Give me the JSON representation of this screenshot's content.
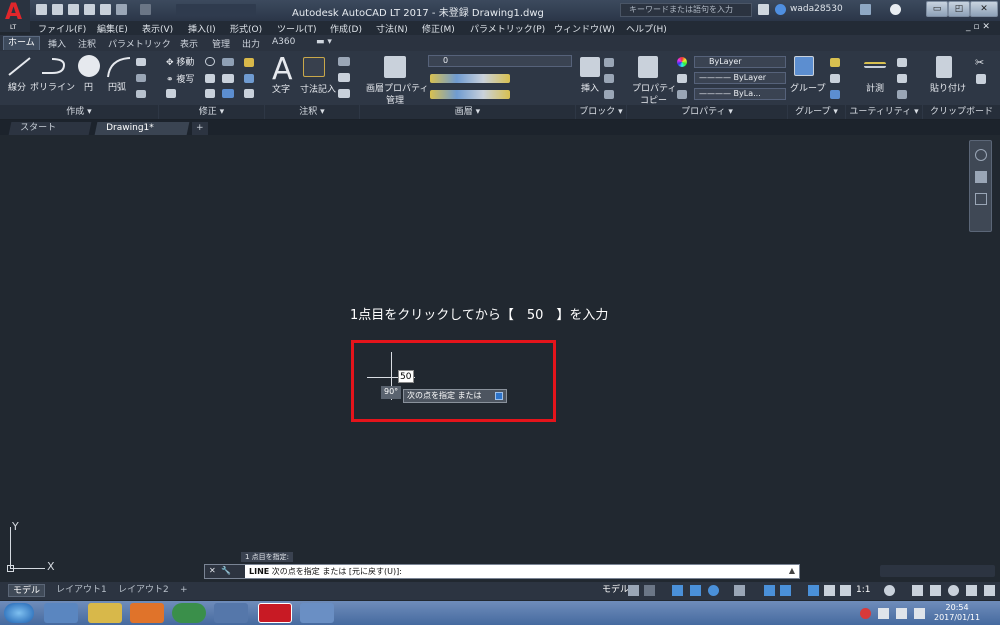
{
  "titlebar": {
    "title": "Autodesk AutoCAD LT 2017 - 未登録    Drawing1.dwg",
    "search_placeholder": "キーワードまたは語句を入力",
    "user": "wada28530",
    "app_logo_letter": "A",
    "app_logo_sub": "LT"
  },
  "menubar": [
    "ファイル(F)",
    "編集(E)",
    "表示(V)",
    "挿入(I)",
    "形式(O)",
    "ツール(T)",
    "作成(D)",
    "寸法(N)",
    "修正(M)",
    "パラメトリック(P)",
    "ウィンドウ(W)",
    "ヘルプ(H)"
  ],
  "ribbon_tabs": [
    "ホーム",
    "挿入",
    "注釈",
    "パラメトリック",
    "表示",
    "管理",
    "出力",
    "A360"
  ],
  "ribbon": {
    "draw": {
      "line": "線分",
      "polyline": "ポリライン",
      "circle": "円",
      "arc": "円弧",
      "footer": "作成 ▾"
    },
    "modify": {
      "move": "移動",
      "copy": "複写",
      "footer": "修正 ▾"
    },
    "annotation": {
      "text": "文字",
      "dimension": "寸法記入",
      "footer": "注釈 ▾"
    },
    "layers": {
      "props_line1": "画層プロパティ",
      "props_line2": "管理",
      "current_layer": "0",
      "footer": "画層 ▾"
    },
    "block": {
      "insert": "挿入",
      "footer": "ブロック ▾"
    },
    "properties": {
      "match_line1": "プロパティ",
      "match_line2": "コピー",
      "bylayer1": "ByLayer",
      "bylayer2": "———— ByLayer",
      "bylayer3": "———— ByLa...",
      "footer": "プロパティ ▾"
    },
    "groups": {
      "group": "グループ",
      "footer": "グループ ▾"
    },
    "utilities": {
      "measure": "計測",
      "footer": "ユーティリティ ▾"
    },
    "clipboard": {
      "paste": "貼り付け",
      "footer": "クリップボード"
    }
  },
  "doc_tabs": [
    "スタート",
    "Drawing1*"
  ],
  "canvas": {
    "instruction": "1点目をクリックしてから【　50　】を入力",
    "dynamic_input_value": "50",
    "angle": "90°",
    "prompt": "次の点を指定 または",
    "ucs_x": "X",
    "ucs_y": "Y"
  },
  "command": {
    "history": "1 点目を指定:",
    "command_name": "LINE",
    "prompt": "次の点を指定 または [元に戻す(U)]:"
  },
  "layout_tabs": [
    "モデル",
    "レイアウト1",
    "レイアウト2"
  ],
  "status": {
    "model": "モデル",
    "scale": "1:1"
  },
  "taskbar": {
    "time": "20:54",
    "date": "2017/01/11"
  },
  "colors": {
    "highlight": "#e5141b",
    "background": "#212830"
  }
}
